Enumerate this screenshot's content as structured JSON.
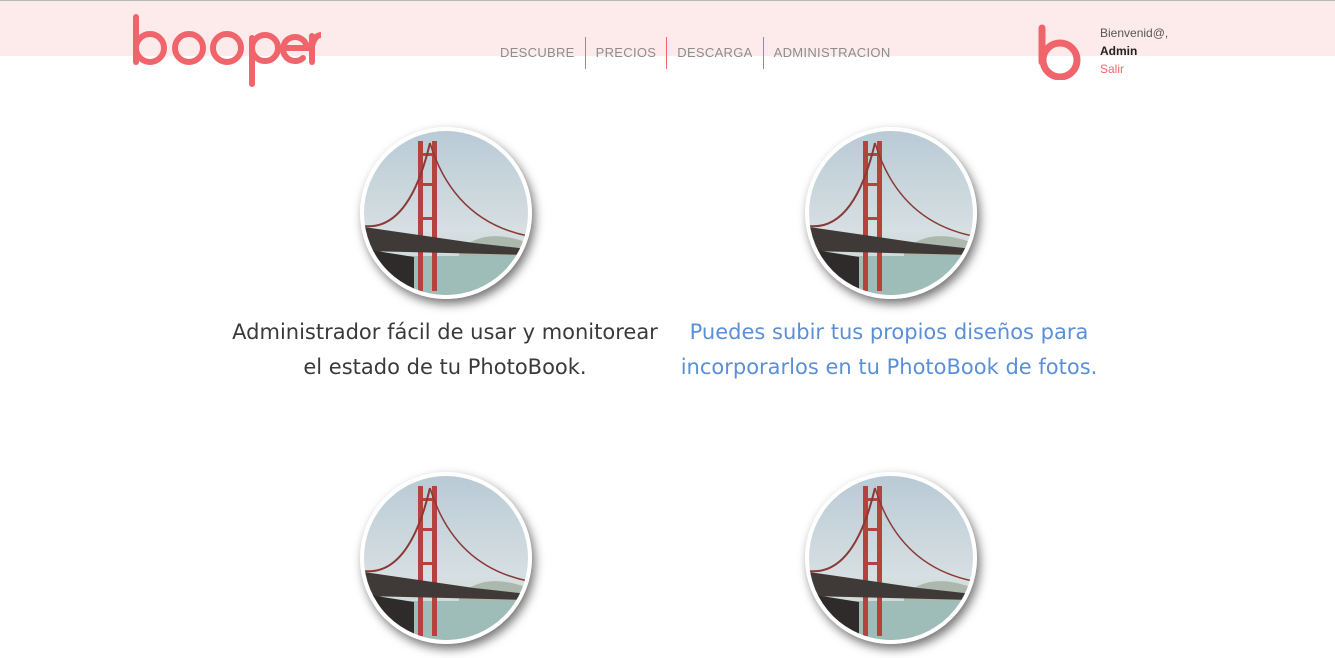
{
  "brand": {
    "name": "booper",
    "color": "#f0656c"
  },
  "nav": {
    "items": [
      {
        "label": "DESCUBRE"
      },
      {
        "label": "PRECIOS"
      },
      {
        "label": "DESCARGA"
      },
      {
        "label": "ADMINISTRACION"
      }
    ]
  },
  "user": {
    "greeting": "Bienvenid@,",
    "name": "Admin",
    "logout_label": "Salir"
  },
  "features": [
    {
      "text": "Administrador fácil de usar y monitorear el estado de tu PhotoBook.",
      "image_icon": "golden-gate-photo"
    },
    {
      "text": "Puedes subir tus propios diseños para incorporarlos en tu PhotoBook de fotos.",
      "image_icon": "golden-gate-photo"
    },
    {
      "text": "",
      "image_icon": "golden-gate-photo"
    },
    {
      "text": "",
      "image_icon": "golden-gate-photo"
    }
  ],
  "colors": {
    "header_bg": "#fdebec",
    "accent": "#f0656c",
    "link": "#5b8fd6"
  }
}
